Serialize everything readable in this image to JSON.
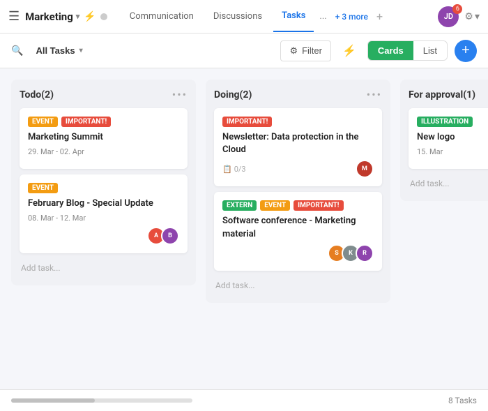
{
  "app": {
    "name": "Marketing",
    "chevron": "▾"
  },
  "nav": {
    "tabs": [
      {
        "label": "Communication",
        "active": false
      },
      {
        "label": "Discussions",
        "active": false
      },
      {
        "label": "Tasks",
        "active": true
      },
      {
        "label": "...",
        "active": false
      }
    ],
    "more_label": "+ 3 more",
    "add_label": "+",
    "avatar_initials": "JD",
    "avatar_count": "6",
    "settings_label": "⚙"
  },
  "toolbar": {
    "all_tasks_label": "All Tasks",
    "filter_label": "Filter",
    "cards_label": "Cards",
    "list_label": "List",
    "add_label": "+"
  },
  "columns": [
    {
      "id": "todo",
      "title": "Todo(2)",
      "cards": [
        {
          "tags": [
            "EVENT",
            "IMPORTANT!"
          ],
          "tag_types": [
            "event",
            "important"
          ],
          "title": "Marketing Summit",
          "date": "29. Mar - 02. Apr",
          "avatars": []
        },
        {
          "tags": [
            "EVENT"
          ],
          "tag_types": [
            "event"
          ],
          "title": "February Blog - Special Update",
          "date": "08. Mar - 12. Mar",
          "avatars": [
            {
              "color": "#e74c3c",
              "initials": "A"
            },
            {
              "color": "#8e44ad",
              "initials": "B"
            }
          ]
        }
      ],
      "add_task_label": "Add task..."
    },
    {
      "id": "doing",
      "title": "Doing(2)",
      "cards": [
        {
          "tags": [
            "IMPORTANT!"
          ],
          "tag_types": [
            "important"
          ],
          "title": "Newsletter: Data protection in the Cloud",
          "date": "",
          "subtask": "0/3",
          "avatars": [
            {
              "color": "#c0392b",
              "initials": "M"
            }
          ]
        },
        {
          "tags": [
            "EXTERN",
            "EVENT",
            "IMPORTANT!"
          ],
          "tag_types": [
            "extern",
            "event",
            "important"
          ],
          "title": "Software conference - Marketing material",
          "date": "",
          "avatars": [
            {
              "color": "#e67e22",
              "initials": "S"
            },
            {
              "color": "#7f8c8d",
              "initials": "K"
            },
            {
              "color": "#8e44ad",
              "initials": "R"
            }
          ]
        }
      ],
      "add_task_label": "Add task..."
    },
    {
      "id": "for-approval",
      "title": "For approval(1)",
      "cards": [
        {
          "tags": [
            "ILLUSTRATION"
          ],
          "tag_types": [
            "illustration"
          ],
          "title": "New logo",
          "date": "15. Mar",
          "avatars": []
        }
      ],
      "add_task_label": "Add task..."
    }
  ],
  "footer": {
    "task_count": "8 Tasks"
  }
}
